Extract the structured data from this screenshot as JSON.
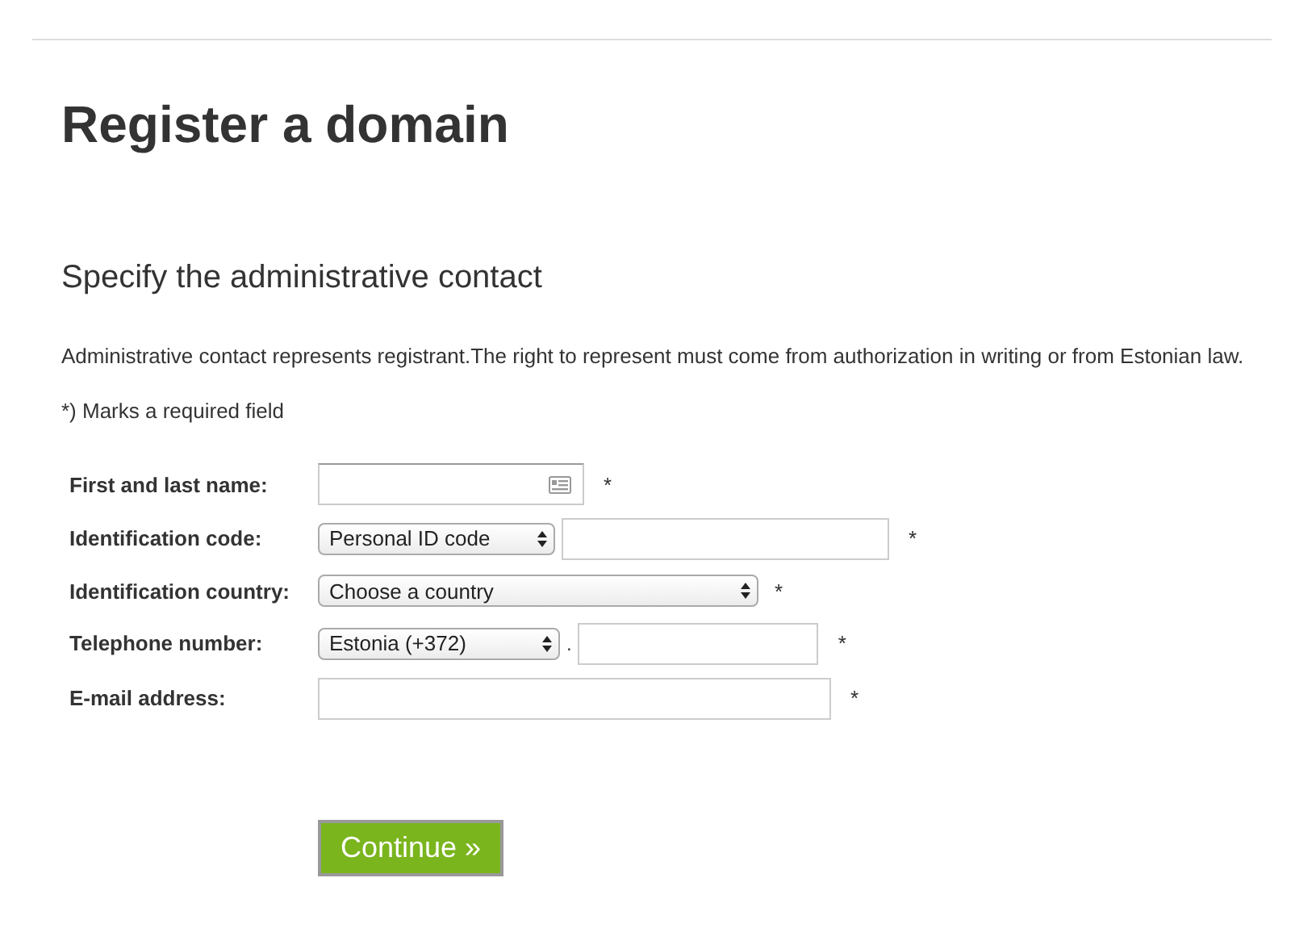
{
  "title": "Register a domain",
  "subtitle": "Specify the administrative contact",
  "description": "Administrative contact represents registrant.The right to represent must come from authorization in writing or from Estonian law.",
  "required_note": "*) Marks a required field",
  "rows": [
    {
      "label": "First and last name:",
      "controls": [
        {
          "kind": "input",
          "contact_card": true
        }
      ],
      "required": "*"
    },
    {
      "label": "Identification code:",
      "controls": [
        {
          "kind": "select",
          "value": "Personal ID code"
        },
        {
          "kind": "input"
        }
      ],
      "required": "*"
    },
    {
      "label": "Identification country:",
      "controls": [
        {
          "kind": "select",
          "value": "Choose a country"
        }
      ],
      "required": "*"
    },
    {
      "label": "Telephone number:",
      "controls": [
        {
          "kind": "select",
          "value": "Estonia (+372)"
        },
        {
          "kind": "separator",
          "text": "."
        },
        {
          "kind": "input"
        }
      ],
      "required": "*"
    },
    {
      "label": "E-mail address:",
      "controls": [
        {
          "kind": "input"
        }
      ],
      "required": "*"
    }
  ],
  "submit": "Continue »"
}
